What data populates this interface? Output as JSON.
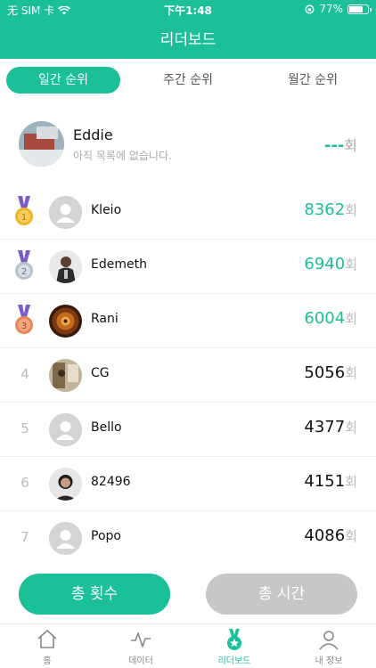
{
  "status_bar": {
    "carrier": "无 SIM 卡",
    "time": "下午1:48",
    "battery": "77%",
    "battery_level": 0.77
  },
  "header": {
    "title": "리더보드"
  },
  "tabs": [
    {
      "label": "일간 순위",
      "active": true
    },
    {
      "label": "주간 순위",
      "active": false
    },
    {
      "label": "월간 순위",
      "active": false
    }
  ],
  "me": {
    "name": "Eddie",
    "subtitle": "아직 목록에 없습니다.",
    "score": "---",
    "unit": "회"
  },
  "leaderboard": [
    {
      "rank": "1",
      "name": "Kleio",
      "score": "8362",
      "unit": "회"
    },
    {
      "rank": "2",
      "name": "Edemeth",
      "score": "6940",
      "unit": "회"
    },
    {
      "rank": "3",
      "name": "Rani",
      "score": "6004",
      "unit": "회"
    },
    {
      "rank": "4",
      "name": "CG",
      "score": "5056",
      "unit": "회"
    },
    {
      "rank": "5",
      "name": "Bello",
      "score": "4377",
      "unit": "회"
    },
    {
      "rank": "6",
      "name": "82496",
      "score": "4151",
      "unit": "회"
    },
    {
      "rank": "7",
      "name": "Popo",
      "score": "4086",
      "unit": "회"
    }
  ],
  "buttons": {
    "total_count": "총 횟수",
    "total_time": "총 시간"
  },
  "tabbar": [
    {
      "label": "홈",
      "icon": "home-icon"
    },
    {
      "label": "데이터",
      "icon": "activity-icon"
    },
    {
      "label": "리더보드",
      "icon": "medal-icon"
    },
    {
      "label": "내 정보",
      "icon": "user-icon"
    }
  ],
  "colors": {
    "accent": "#1bbf98",
    "gold": "#f0b429",
    "silver": "#b8c2cc",
    "bronze": "#e9855a",
    "inactive_button": "#c7c7c7"
  }
}
